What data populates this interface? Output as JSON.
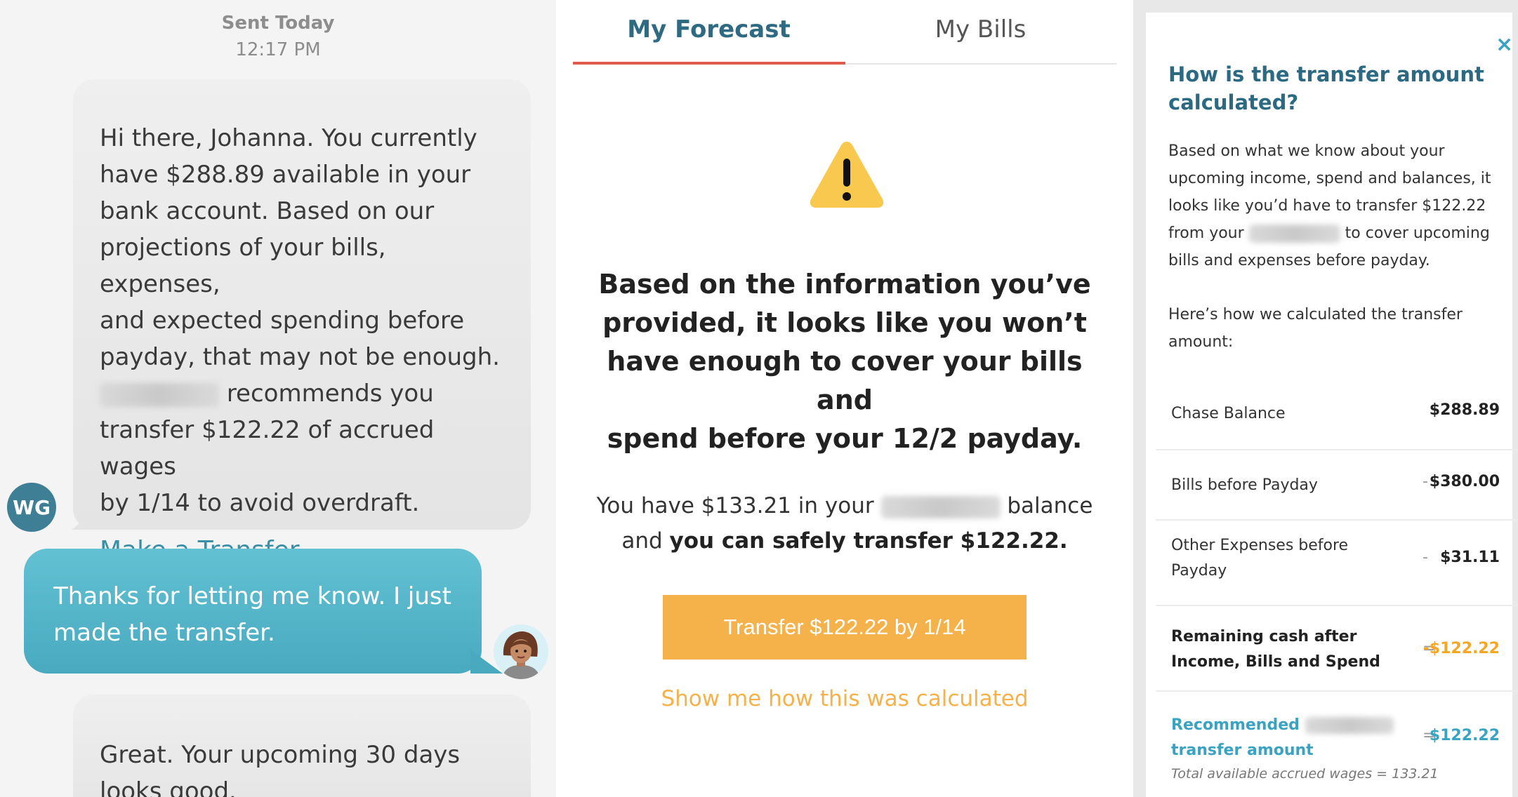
{
  "chat": {
    "sent_label": "Sent Today",
    "sent_time": "12:17 PM",
    "message_1": {
      "lines": [
        "Hi there, Johanna. You currently",
        "have $288.89 available in your",
        "bank account. Based on our",
        "projections of your bills, expenses,",
        "and expected spending before",
        "payday, that may not be enough."
      ],
      "line_after_blur": "recommends you",
      "lines_tail": [
        "transfer $122.22 of accrued wages",
        "by 1/14 to avoid overdraft."
      ],
      "link": "Make a Transfer."
    },
    "bot_avatar": "WG",
    "message_2": [
      "Thanks for letting me know. I just",
      "made the transfer."
    ],
    "message_3": [
      "Great. Your upcoming 30 days",
      "looks good."
    ]
  },
  "forecast": {
    "tabs": [
      "My Forecast",
      "My Bills"
    ],
    "active_tab": "My Forecast",
    "icon": "warning-icon",
    "headline": [
      "Based on the information you’ve",
      "provided, it looks like you won’t",
      "have enough to cover your bills and",
      "spend before your 12/2 payday."
    ],
    "balance_pre": "You have $133.21 in your",
    "balance_post": "balance",
    "and_text": "and",
    "safe_transfer": "you can safely transfer $122.22.",
    "button": "Transfer $122.22 by 1/14",
    "calc_link": "Show me how this was calculated"
  },
  "calc": {
    "close": "×",
    "title": "How is the transfer amount calculated?",
    "intro_pre": "Based on what we know about your upcoming income, spend and balances, it looks like you’d have to transfer $122.22 from your",
    "intro_post": "to cover upcoming bills and expenses before payday.",
    "howto": "Here’s how we calculated the transfer amount:",
    "rows": [
      {
        "label": "Chase Balance",
        "op": "",
        "value": "$288.89"
      },
      {
        "label": "Bills before Payday",
        "op": "-",
        "value": "$380.00"
      },
      {
        "label": "Other Expenses before Payday",
        "op": "-",
        "value": "$31.11"
      },
      {
        "label": "Remaining cash after Income, Bills and Spend",
        "op": "=",
        "value": "-$122.22"
      },
      {
        "label_pre": "Recommended",
        "label_post": "transfer amount",
        "op": "=",
        "value": "$122.22"
      }
    ],
    "note": "Total available accrued wages = 133.21"
  },
  "colors": {
    "teal_dark": "#2e6b83",
    "teal": "#3aa3c2",
    "orange": "#f5b24a",
    "tab_underline": "#e05a4e",
    "user_bubble": "#52b3c8"
  }
}
